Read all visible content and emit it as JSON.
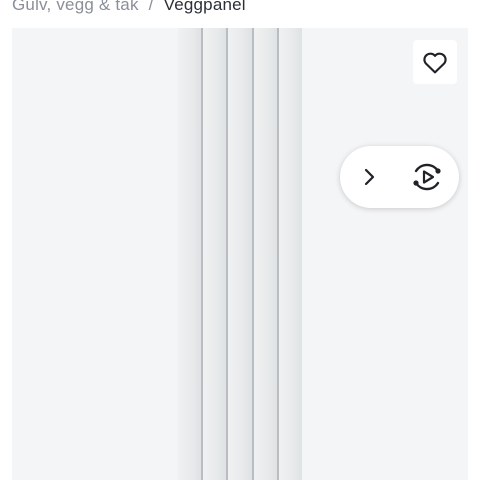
{
  "breadcrumb": {
    "items": [
      {
        "label": "Gulv, vegg & tak"
      }
    ],
    "separator": "/",
    "current": "Veggpanel"
  },
  "gallery": {
    "icons": {
      "wishlist": "heart-outline-icon",
      "next": "chevron-right-icon",
      "media": "rotate-play-icon"
    },
    "colors": {
      "icon": "#1f2328",
      "muted_text": "#8a8f98",
      "current_text": "#2b2f36"
    }
  }
}
